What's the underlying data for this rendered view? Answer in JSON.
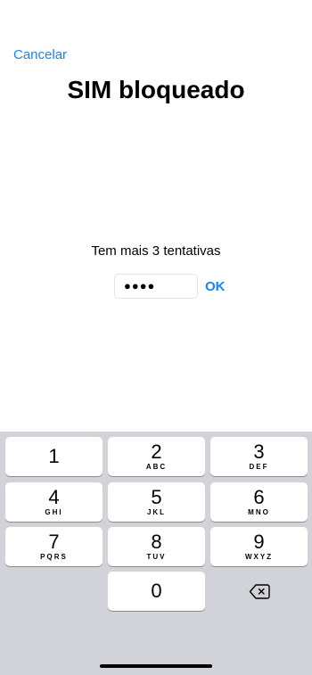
{
  "header": {
    "cancel_label": "Cancelar",
    "title": "SIM bloqueado"
  },
  "main": {
    "attempts_text": "Tem mais 3 tentativas",
    "pin_masked": "●●●●",
    "ok_label": "OK"
  },
  "keypad": {
    "keys": [
      {
        "digit": "1",
        "letters": ""
      },
      {
        "digit": "2",
        "letters": "ABC"
      },
      {
        "digit": "3",
        "letters": "DEF"
      },
      {
        "digit": "4",
        "letters": "GHI"
      },
      {
        "digit": "5",
        "letters": "JKL"
      },
      {
        "digit": "6",
        "letters": "MNO"
      },
      {
        "digit": "7",
        "letters": "PQRS"
      },
      {
        "digit": "8",
        "letters": "TUV"
      },
      {
        "digit": "9",
        "letters": "WXYZ"
      },
      {
        "digit": "0",
        "letters": ""
      }
    ],
    "delete_icon": "backspace-icon"
  },
  "colors": {
    "accent": "#1a84ea",
    "keyboard_bg": "#d1d3d9",
    "key_bg": "#ffffff"
  }
}
